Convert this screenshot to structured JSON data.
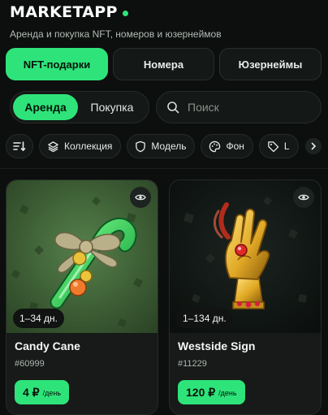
{
  "header": {
    "logo": "MARKETAPP",
    "subtitle": "Аренда и покупка NFT, номеров и юзернеймов"
  },
  "category_tabs": [
    {
      "label": "NFT-подарки",
      "active": true
    },
    {
      "label": "Номера",
      "active": false
    },
    {
      "label": "Юзернеймы",
      "active": false
    }
  ],
  "mode_toggle": [
    {
      "label": "Аренда",
      "active": true
    },
    {
      "label": "Покупка",
      "active": false
    }
  ],
  "search": {
    "placeholder": "Поиск"
  },
  "filters": [
    {
      "label": "Коллекция",
      "icon": "layers-icon"
    },
    {
      "label": "Модель",
      "icon": "shield-icon"
    },
    {
      "label": "Фон",
      "icon": "palette-icon"
    },
    {
      "label": "L",
      "icon": "tag-icon"
    }
  ],
  "listings": [
    {
      "rent_period": "1–34 дн.",
      "name": "Candy Cane",
      "number": "#60999",
      "price": "4 ₽",
      "unit": "/день"
    },
    {
      "rent_period": "1–134 дн.",
      "name": "Westside Sign",
      "number": "#11229",
      "price": "120 ₽",
      "unit": "/день"
    }
  ],
  "colors": {
    "accent": "#2ee47a",
    "background": "#0c0f0d",
    "card": "#171a18",
    "card1_bg": "#3b5a2f",
    "card2_bg": "#0f1411"
  }
}
